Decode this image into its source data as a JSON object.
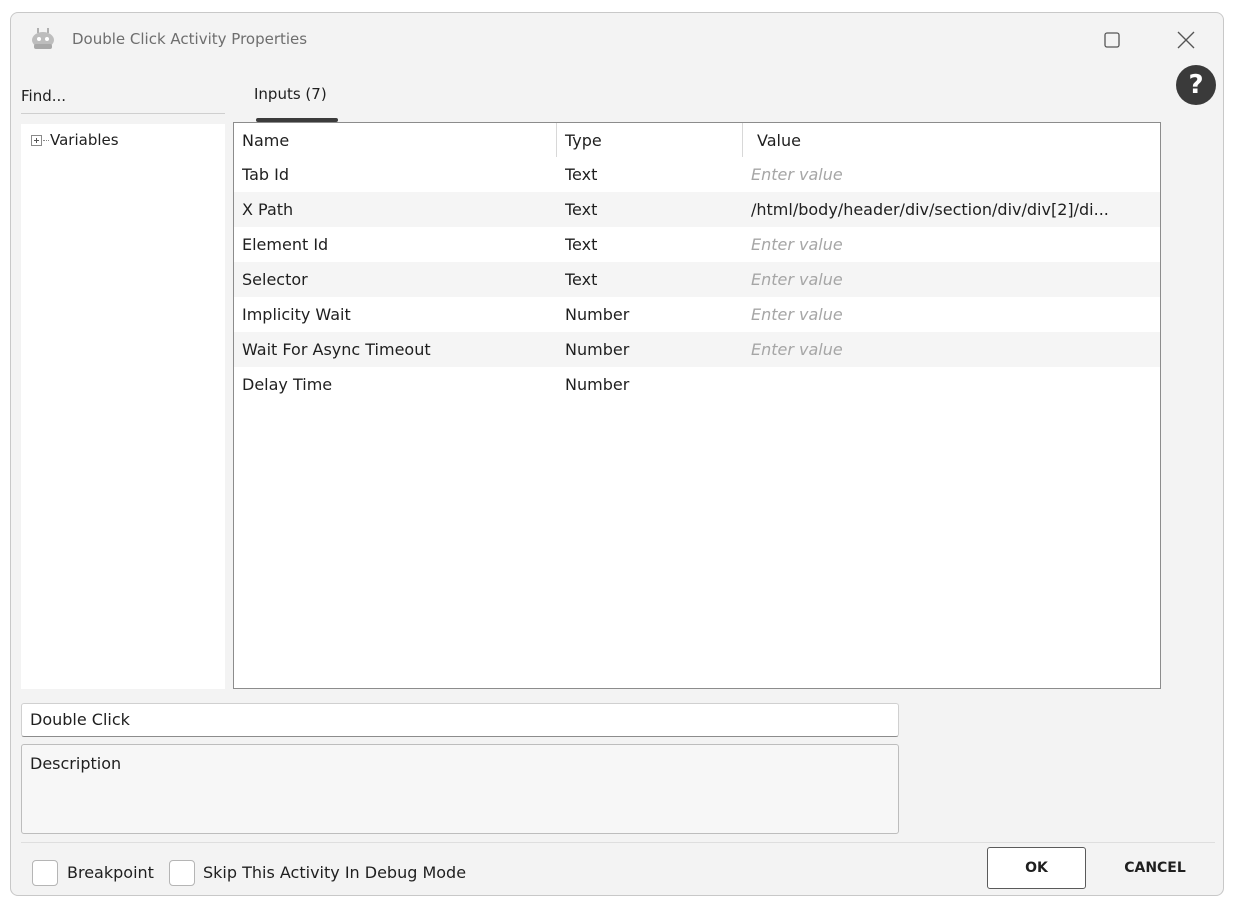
{
  "window": {
    "title": "Double Click Activity Properties",
    "app_icon": "robot-icon",
    "maximize_icon": "maximize-icon",
    "close_icon": "close-icon",
    "help_symbol": "?"
  },
  "sidebar": {
    "find_label": "Find...",
    "tree": [
      {
        "label": "Variables",
        "expander": "+"
      }
    ]
  },
  "tabs": [
    {
      "label": "Inputs (7)",
      "active": true
    }
  ],
  "grid": {
    "columns": [
      "Name",
      "Type",
      "Value"
    ],
    "rows": [
      {
        "name": "Tab Id",
        "type": "Text",
        "value": "Enter value",
        "placeholder": true
      },
      {
        "name": "X Path",
        "type": "Text",
        "value": "/html/body/header/div/section/div/div[2]/di...",
        "placeholder": false
      },
      {
        "name": "Element Id",
        "type": "Text",
        "value": "Enter value",
        "placeholder": true
      },
      {
        "name": "Selector",
        "type": "Text",
        "value": "Enter value",
        "placeholder": true
      },
      {
        "name": "Implicity Wait",
        "type": "Number",
        "value": "Enter value",
        "placeholder": true
      },
      {
        "name": "Wait For Async Timeout",
        "type": "Number",
        "value": "Enter value",
        "placeholder": true
      },
      {
        "name": "Delay Time",
        "type": "Number",
        "value": "",
        "placeholder": false
      }
    ]
  },
  "activity": {
    "name_value": "Double Click",
    "description_placeholder": "Description"
  },
  "footer": {
    "breakpoint_label": "Breakpoint",
    "breakpoint_checked": false,
    "skip_label": "Skip This Activity In Debug Mode",
    "skip_checked": false,
    "ok_label": "OK",
    "cancel_label": "CANCEL"
  },
  "colors": {
    "window_bg": "#f3f3f3",
    "grid_border": "#8c8c8c",
    "placeholder_text": "#a6a6a6",
    "tab_indicator": "#3b3b3b"
  }
}
